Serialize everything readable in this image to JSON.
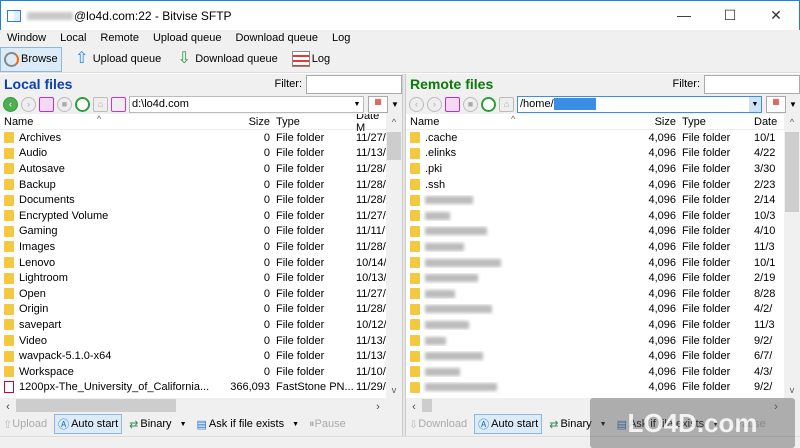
{
  "window": {
    "title": "@lo4d.com:22 - Bitvise SFTP",
    "minimize": "—",
    "maximize": "☐",
    "close": "✕"
  },
  "menu": [
    "Window",
    "Local",
    "Remote",
    "Upload queue",
    "Download queue",
    "Log"
  ],
  "toolbar": {
    "browse": "Browse",
    "upload_queue": "Upload queue",
    "download_queue": "Download queue",
    "log": "Log"
  },
  "local": {
    "title": "Local files",
    "filter_label": "Filter:",
    "filter_value": "",
    "path": "d:\\lo4d.com",
    "columns": {
      "name": "Name",
      "size": "Size",
      "type": "Type",
      "date": "Date M"
    },
    "rows": [
      {
        "name": "Archives",
        "size": "0",
        "type": "File folder",
        "date": "11/27/"
      },
      {
        "name": "Audio",
        "size": "0",
        "type": "File folder",
        "date": "11/13/"
      },
      {
        "name": "Autosave",
        "size": "0",
        "type": "File folder",
        "date": "11/28/"
      },
      {
        "name": "Backup",
        "size": "0",
        "type": "File folder",
        "date": "11/28/"
      },
      {
        "name": "Documents",
        "size": "0",
        "type": "File folder",
        "date": "11/28/"
      },
      {
        "name": "Encrypted Volume",
        "size": "0",
        "type": "File folder",
        "date": "11/27/"
      },
      {
        "name": "Gaming",
        "size": "0",
        "type": "File folder",
        "date": "11/11/"
      },
      {
        "name": "Images",
        "size": "0",
        "type": "File folder",
        "date": "11/28/"
      },
      {
        "name": "Lenovo",
        "size": "0",
        "type": "File folder",
        "date": "10/14/"
      },
      {
        "name": "Lightroom",
        "size": "0",
        "type": "File folder",
        "date": "10/13/"
      },
      {
        "name": "Open",
        "size": "0",
        "type": "File folder",
        "date": "11/27/"
      },
      {
        "name": "Origin",
        "size": "0",
        "type": "File folder",
        "date": "11/28/"
      },
      {
        "name": "savepart",
        "size": "0",
        "type": "File folder",
        "date": "10/12/"
      },
      {
        "name": "Video",
        "size": "0",
        "type": "File folder",
        "date": "11/13/"
      },
      {
        "name": "wavpack-5.1.0-x64",
        "size": "0",
        "type": "File folder",
        "date": "11/13/"
      },
      {
        "name": "Workspace",
        "size": "0",
        "type": "File folder",
        "date": "11/10/"
      },
      {
        "name": "1200px-The_University_of_California...",
        "size": "366,093",
        "type": "FastStone PN...",
        "date": "11/29/",
        "file": true
      }
    ]
  },
  "remote": {
    "title": "Remote files",
    "filter_label": "Filter:",
    "filter_value": "",
    "path": "/home/",
    "columns": {
      "name": "Name",
      "size": "Size",
      "type": "Type",
      "date": "Date"
    },
    "rows": [
      {
        "name": ".cache",
        "size": "4,096",
        "type": "File folder",
        "date": "10/1"
      },
      {
        "name": ".elinks",
        "size": "4,096",
        "type": "File folder",
        "date": "4/22"
      },
      {
        "name": ".pki",
        "size": "4,096",
        "type": "File folder",
        "date": "3/30"
      },
      {
        "name": ".ssh",
        "size": "4,096",
        "type": "File folder",
        "date": "2/23"
      },
      {
        "name": "",
        "size": "4,096",
        "type": "File folder",
        "date": "2/14"
      },
      {
        "name": "",
        "size": "4,096",
        "type": "File folder",
        "date": "10/3"
      },
      {
        "name": "",
        "size": "4,096",
        "type": "File folder",
        "date": "4/10"
      },
      {
        "name": "",
        "size": "4,096",
        "type": "File folder",
        "date": "11/3"
      },
      {
        "name": "",
        "size": "4,096",
        "type": "File folder",
        "date": "10/1"
      },
      {
        "name": "",
        "size": "4,096",
        "type": "File folder",
        "date": "2/19"
      },
      {
        "name": "",
        "size": "4,096",
        "type": "File folder",
        "date": "8/28"
      },
      {
        "name": "",
        "size": "4,096",
        "type": "File folder",
        "date": "4/2/"
      },
      {
        "name": "",
        "size": "4,096",
        "type": "File folder",
        "date": "11/3"
      },
      {
        "name": "",
        "size": "4,096",
        "type": "File folder",
        "date": "9/2/"
      },
      {
        "name": "",
        "size": "4,096",
        "type": "File folder",
        "date": "6/7/"
      },
      {
        "name": "",
        "size": "4,096",
        "type": "File folder",
        "date": "4/3/"
      },
      {
        "name": "",
        "size": "4,096",
        "type": "File folder",
        "date": "9/2/"
      }
    ]
  },
  "upload_bar": {
    "upload": "Upload",
    "auto_start": "Auto start",
    "binary": "Binary",
    "ask": "Ask if file exists",
    "pause": "Pause"
  },
  "download_bar": {
    "download": "Download",
    "auto_start": "Auto start",
    "binary": "Binary",
    "ask": "Ask if file exists",
    "pause": "Pause"
  },
  "watermark": "LO4D.com",
  "colors": {
    "local_title": "#0a3fb8",
    "remote_title": "#0a7a0a",
    "accent": "#1883d7"
  }
}
